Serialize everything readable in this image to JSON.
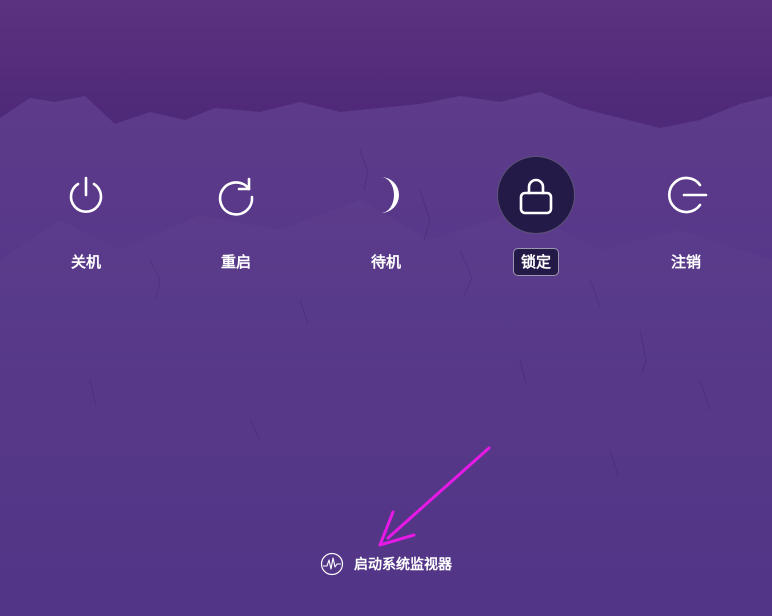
{
  "power_menu": {
    "options": [
      {
        "label": "关机",
        "icon": "power-icon"
      },
      {
        "label": "重启",
        "icon": "restart-icon"
      },
      {
        "label": "待机",
        "icon": "moon-icon"
      },
      {
        "label": "锁定",
        "icon": "lock-icon",
        "selected": true
      },
      {
        "label": "注销",
        "icon": "logout-icon"
      }
    ]
  },
  "system_monitor": {
    "label": "启动系统监视器",
    "icon": "system-monitor-icon"
  },
  "annotation": {
    "icon": "arrow-icon",
    "color": "#e619e6"
  },
  "colors": {
    "background": "#4a2a7c",
    "selected_bg": "#241a48",
    "text": "#ffffff"
  }
}
